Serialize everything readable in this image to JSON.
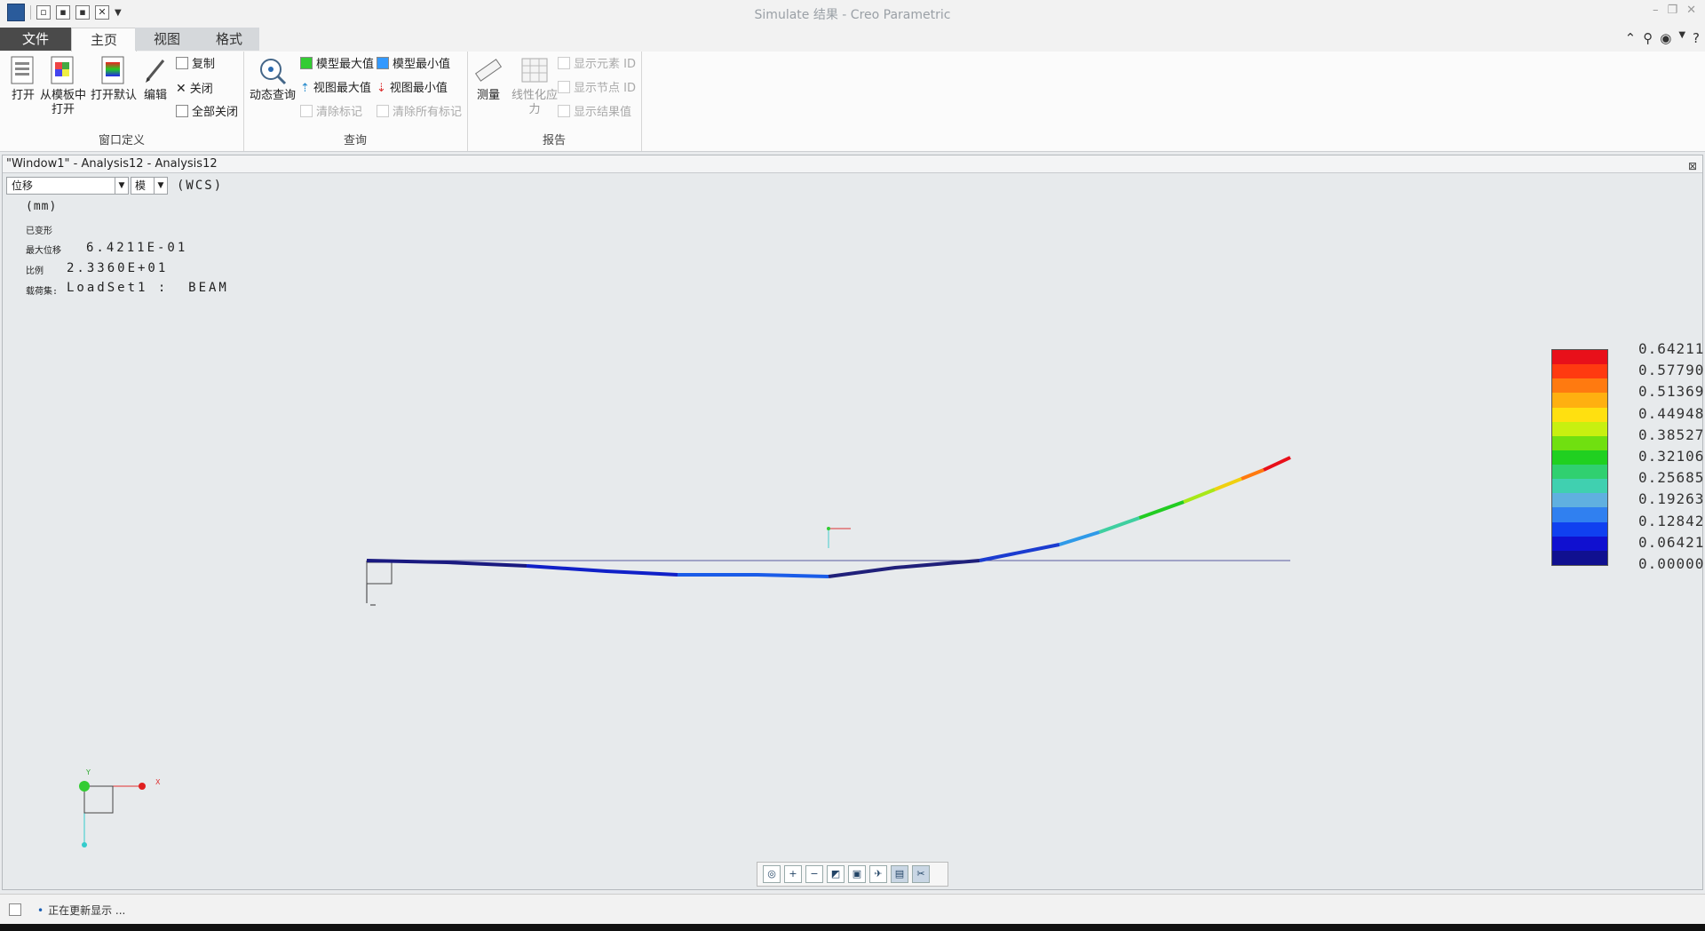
{
  "window": {
    "title": "Simulate 结果 - Creo Parametric"
  },
  "tabs": {
    "file": "文件",
    "home": "主页",
    "view": "视图",
    "format": "格式"
  },
  "ribbon": {
    "window_def": {
      "label": "窗口定义",
      "open": "打开",
      "open_template_1": "从模板中",
      "open_template_2": "打开",
      "open_default": "打开默认",
      "edit": "编辑",
      "copy": "复制",
      "close": "关闭",
      "close_all": "全部关闭"
    },
    "query": {
      "label": "查询",
      "dynamic_query": "动态查询",
      "model_max": "模型最大值",
      "model_min": "模型最小值",
      "view_max": "视图最大值",
      "view_min": "视图最小值",
      "clear_mark": "清除标记",
      "clear_all_marks": "清除所有标记"
    },
    "report": {
      "label": "报告",
      "measure": "测量",
      "linearize_1": "线性化应",
      "linearize_2": "力",
      "show_element_id": "显示元素 ID",
      "show_node_id": "显示节点 ID",
      "show_result_values": "显示结果值"
    }
  },
  "graphics": {
    "title": "\"Window1\" - Analysis12 - Analysis12",
    "quantity": "位移",
    "component": "模",
    "csys": "(WCS)",
    "units": "(mm)",
    "deformed": "已变形",
    "max_disp_label": "最大位移",
    "max_disp_value": "6.4211E-01",
    "scale_label": "比例",
    "scale_value": "2.3360E+01",
    "loadset_label": "载荷集:",
    "loadset_value": "LoadSet1 :  BEAM",
    "axis_x": "X",
    "axis_y": "Y"
  },
  "legend": {
    "values": [
      "0.64211",
      "0.57790",
      "0.51369",
      "0.44948",
      "0.38527",
      "0.32106",
      "0.25685",
      "0.19263",
      "0.12842",
      "0.06421",
      "0.00000"
    ],
    "colors": [
      "#e8101a",
      "#ff3a10",
      "#ff7a10",
      "#ffb010",
      "#ffe010",
      "#c8f010",
      "#70e010",
      "#20d020",
      "#30d070",
      "#40d0b0",
      "#60b0e0",
      "#3080f0",
      "#1040f0",
      "#1010d0",
      "#101090"
    ]
  },
  "status": {
    "message": "正在更新显示 ..."
  }
}
